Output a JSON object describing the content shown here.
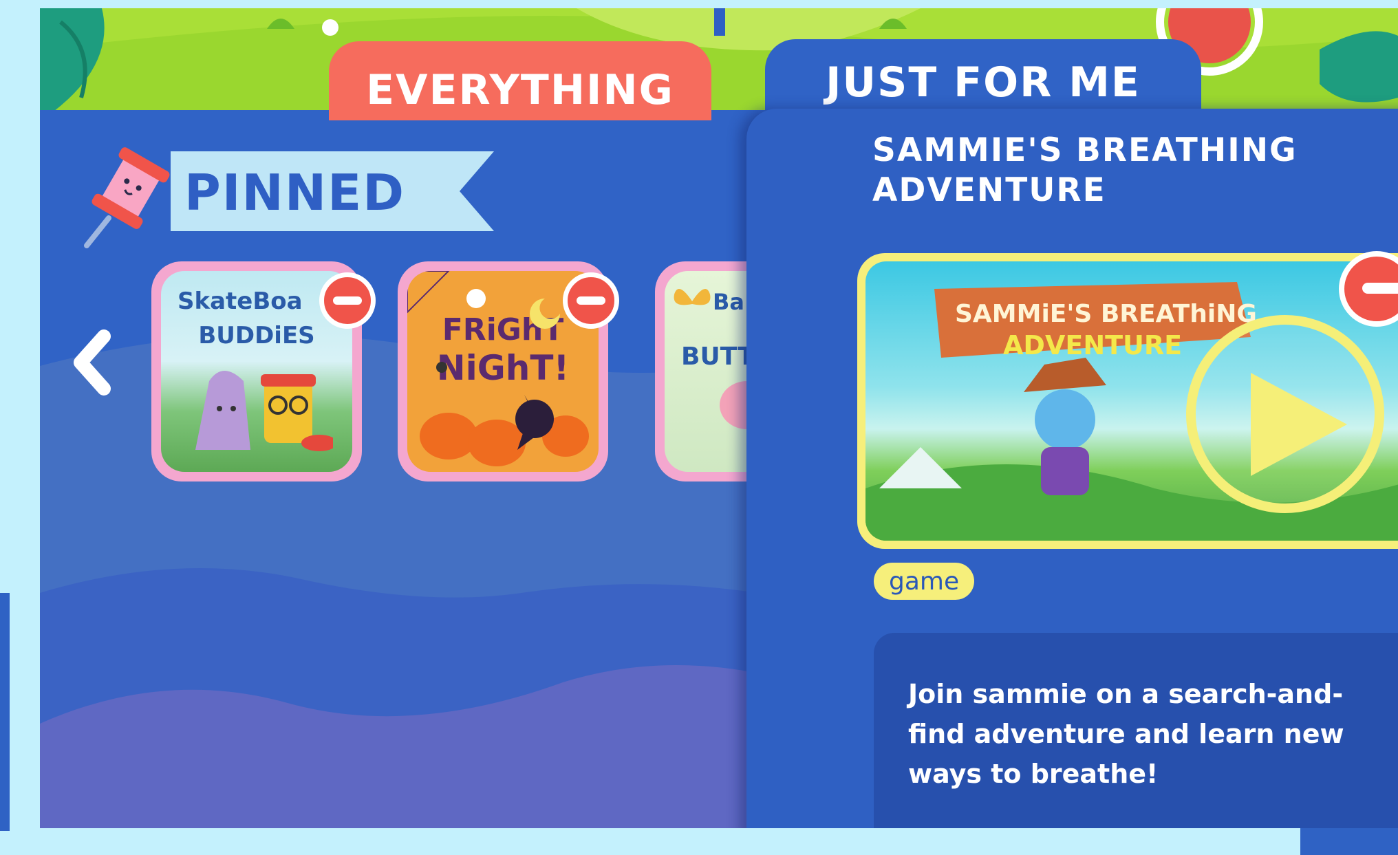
{
  "tabs": {
    "everything_label": "EVERYTHING",
    "just_for_me_label": "JUST FOR ME"
  },
  "pinned": {
    "heading": "PINNED",
    "cards": [
      {
        "title_line1": "SkateBoa",
        "title_line2": "BUDDiES"
      },
      {
        "title_line1": "FRiGhT",
        "title_line2": "NiGhT!"
      },
      {
        "title_line1": "Ba",
        "title_line2": "BUTT"
      }
    ]
  },
  "feature": {
    "title_line1": "SAMMIE'S BREATHING",
    "title_line2": "ADVENTURE",
    "art_sign_line1": "SAMMiE'S BREAThiNG",
    "art_sign_line2": "ADVENTURE",
    "tag": "game",
    "description": "Join sammie on a search-and-find adventure and learn new ways to breathe!"
  },
  "colors": {
    "page_bg": "#c4f1fd",
    "panel_blue": "#3063c6",
    "tab_coral": "#f66c5d",
    "card_pink": "#f4a7cf",
    "accent_yellow": "#f6ef7b",
    "remove_red": "#f0544a"
  },
  "icons": [
    "pin-icon",
    "chevron-left-icon",
    "remove-icon",
    "play-icon"
  ]
}
